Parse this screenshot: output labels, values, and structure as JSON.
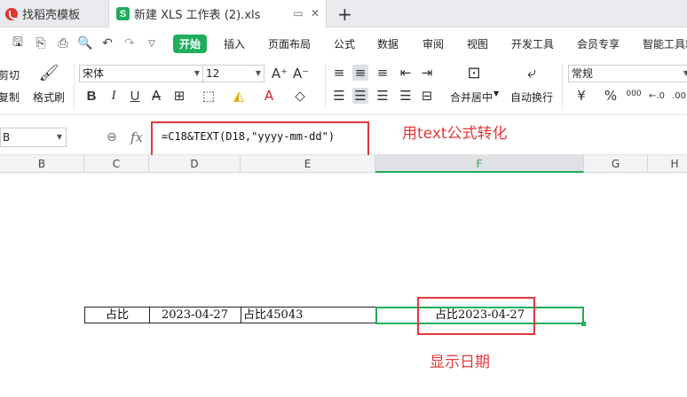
{
  "tabs": [
    {
      "label": "找稻壳模板"
    },
    {
      "label": "新建 XLS 工作表 (2).xls"
    }
  ],
  "menu": {
    "active": "开始",
    "items": [
      "插入",
      "页面布局",
      "公式",
      "数据",
      "审阅",
      "视图",
      "开发工具",
      "会员专享",
      "智能工具箱"
    ]
  },
  "ribbon": {
    "cut_label": "剪切",
    "copy_label": "复制",
    "format_painter_label": "格式刷",
    "font_name": "宋体",
    "font_size": "12",
    "merge_label": "合并居中",
    "wrap_label": "自动换行",
    "number_format": "常规",
    "bold_label": "B",
    "italic_label": "I",
    "underline_label": "U",
    "currency_symbol": "¥",
    "percent_symbol": "%",
    "thousands_symbol": "000"
  },
  "formula_bar": {
    "name_box": "B",
    "fx": "fx",
    "formula": "=C18&TEXT(D18,\"yyyy-mm-dd\")"
  },
  "columns": [
    "B",
    "C",
    "D",
    "E",
    "F",
    "G",
    "H"
  ],
  "active_column": "F",
  "row": {
    "C": "占比",
    "D": "2023-04-27",
    "E": "占比45043",
    "F": "占比2023-04-27"
  },
  "annotations": {
    "formula_note": "用text公式转化",
    "result_note": "显示日期"
  },
  "colors": {
    "accent_green": "#1fae5b",
    "annotation_red": "#e03a3a"
  }
}
